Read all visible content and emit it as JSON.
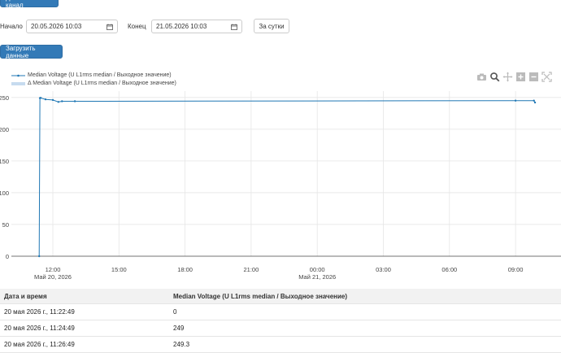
{
  "top": {
    "add_channel_label": "Добавить канал",
    "start_label": "Начало",
    "start_value": "20.05.2026 10:03",
    "end_label": "Конец",
    "end_value": "21.05.2026 10:03",
    "day_button": "За сутки",
    "load_button": "Загрузить данные"
  },
  "legend": {
    "series1": "Median Voltage (U L1rms median / Выходное значение)",
    "series2": "Δ Median Voltage (U L1rms median / Выходное значение)"
  },
  "chart_data": {
    "type": "line",
    "series": [
      {
        "name": "Median Voltage (U L1rms median / Выходное значение)",
        "x": [
          "2026-05-20 11:22:49",
          "2026-05-20 11:24:49",
          "2026-05-20 11:26:49",
          "2026-05-20 11:40",
          "2026-05-20 12:00",
          "2026-05-20 12:15",
          "2026-05-20 12:25",
          "2026-05-20 13:00",
          "2026-05-21 09:00",
          "2026-05-21 09:50",
          "2026-05-21 09:53"
        ],
        "y": [
          0,
          249,
          249.3,
          247,
          246,
          243,
          244,
          244,
          245,
          245,
          242
        ]
      }
    ],
    "x_ticks": [
      "12:00",
      "15:00",
      "18:00",
      "21:00",
      "00:00",
      "03:00",
      "06:00",
      "09:00"
    ],
    "x_date_labels": [
      {
        "at": "12:00",
        "text": "Май 20, 2026"
      },
      {
        "at": "00:00",
        "text": "Май 21, 2026"
      }
    ],
    "y_ticks": [
      "0",
      "50",
      "100",
      "150",
      "200",
      "250"
    ],
    "ylim": [
      0,
      260
    ],
    "grid": true,
    "line_color": "#1f77b4"
  },
  "table": {
    "headers": [
      "Дата и время",
      "Median Voltage (U L1rms median / Выходное значение)"
    ],
    "rows": [
      [
        "20 мая 2026 г., 11:22:49",
        "0"
      ],
      [
        "20 мая 2026 г., 11:24:49",
        "249"
      ],
      [
        "20 мая 2026 г., 11:26:49",
        "249.3"
      ]
    ]
  }
}
